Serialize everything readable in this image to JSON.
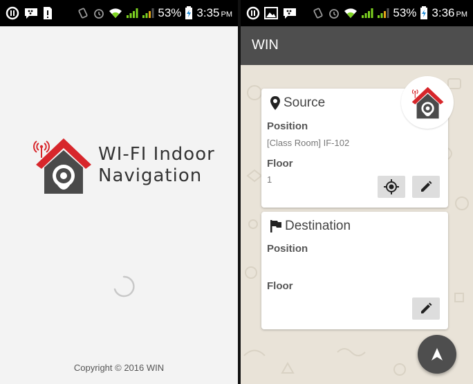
{
  "status_left": {
    "battery_pct": "53%",
    "time": "3:35",
    "ampm": "PM",
    "icons": [
      "bbm-icon",
      "blackberry-messenger-icon",
      "sim-alert-icon",
      "vibrate-icon",
      "alarm-icon",
      "wifi-icon",
      "signal-icon",
      "signal-icon-2",
      "battery-charging-icon"
    ]
  },
  "status_right": {
    "battery_pct": "53%",
    "time": "3:36",
    "ampm": "PM",
    "icons": [
      "bbm-icon",
      "image-icon",
      "blackberry-messenger-icon",
      "vibrate-icon",
      "alarm-icon",
      "wifi-icon",
      "signal-icon",
      "signal-icon-2",
      "battery-charging-icon"
    ]
  },
  "splash": {
    "logo_line1": "WI-FI Indoor",
    "logo_line2": "Navigation",
    "copyright": "Copyright © 2016 WIN"
  },
  "app": {
    "title": "WIN",
    "source": {
      "heading": "Source",
      "position_label": "Position",
      "position_value": "[Class Room] IF-102",
      "floor_label": "Floor",
      "floor_value": "1"
    },
    "destination": {
      "heading": "Destination",
      "position_label": "Position",
      "position_value": "",
      "floor_label": "Floor",
      "floor_value": ""
    }
  },
  "colors": {
    "accent_red": "#d7262b",
    "house_dark": "#4a4a4a",
    "app_bar": "#4e4e4e",
    "statusbar": "#000000",
    "icon_green": "#7ed321"
  }
}
